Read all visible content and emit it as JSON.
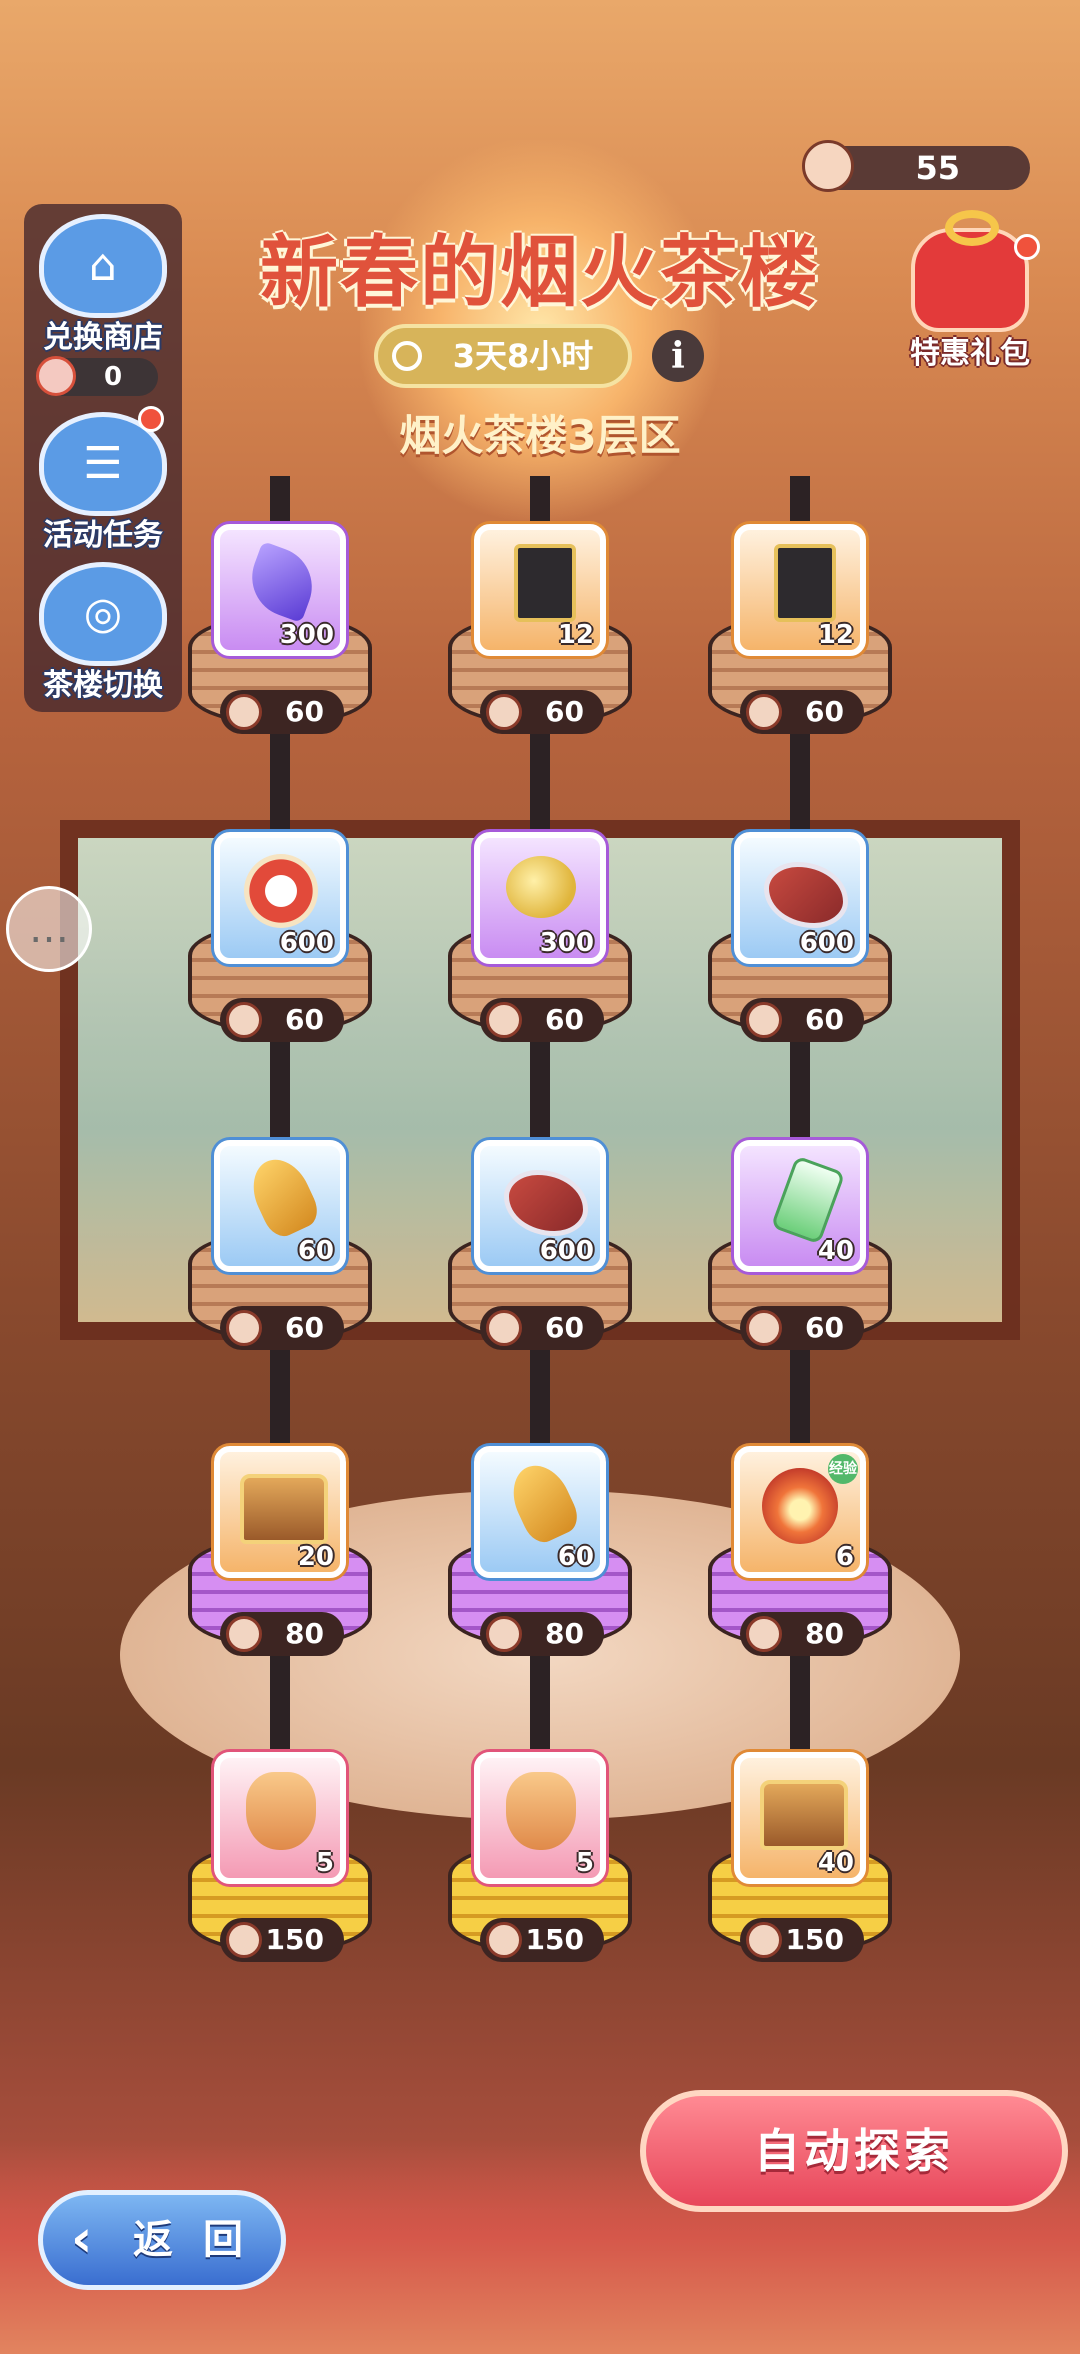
{
  "header": {
    "coin_count": "55",
    "title": "新春的烟火茶楼",
    "timer": "3天8小时",
    "info_symbol": "i",
    "floor_label": "烟火茶楼3层区"
  },
  "sidebar": {
    "items": [
      {
        "label": "兑换商店",
        "icon": "shop-icon",
        "glyph": "⌂"
      },
      {
        "label": "活动任务",
        "icon": "task-clipboard-icon",
        "glyph": "☰"
      },
      {
        "label": "茶楼切换",
        "icon": "steamer-switch-icon",
        "glyph": "◎"
      }
    ],
    "token_count": "0"
  },
  "gift": {
    "label": "特惠礼包",
    "icon": "gift-bag-icon"
  },
  "chat": {
    "icon": "chat-bubble-icon",
    "glyph": "…"
  },
  "grid": {
    "rows": [
      {
        "tier": "wood",
        "cells": [
          {
            "item": "crystal",
            "rarity": "purple",
            "qty": "300",
            "cost": "60"
          },
          {
            "item": "ticket",
            "rarity": "orange",
            "qty": "12",
            "cost": "60"
          },
          {
            "item": "ticket",
            "rarity": "orange",
            "qty": "12",
            "cost": "60"
          }
        ]
      },
      {
        "tier": "wood",
        "cells": [
          {
            "item": "plate",
            "rarity": "blue",
            "qty": "600",
            "cost": "60"
          },
          {
            "item": "gold",
            "rarity": "purple",
            "qty": "300",
            "cost": "60"
          },
          {
            "item": "meat",
            "rarity": "blue",
            "qty": "600",
            "cost": "60"
          }
        ]
      },
      {
        "tier": "wood",
        "cells": [
          {
            "item": "amber",
            "rarity": "blue",
            "qty": "60",
            "cost": "60"
          },
          {
            "item": "meat",
            "rarity": "blue",
            "qty": "600",
            "cost": "60"
          },
          {
            "item": "bottle",
            "rarity": "purple",
            "qty": "40",
            "cost": "60"
          }
        ]
      },
      {
        "tier": "purple",
        "cells": [
          {
            "item": "chest",
            "rarity": "orange",
            "qty": "20",
            "cost": "80"
          },
          {
            "item": "amber",
            "rarity": "blue",
            "qty": "60",
            "cost": "80"
          },
          {
            "item": "orb",
            "rarity": "orange",
            "qty": "6",
            "cost": "80",
            "badge": "经验"
          }
        ]
      },
      {
        "tier": "gold",
        "cells": [
          {
            "item": "fox",
            "rarity": "pink",
            "qty": "5",
            "cost": "150"
          },
          {
            "item": "fox",
            "rarity": "pink",
            "qty": "5",
            "cost": "150"
          },
          {
            "item": "chest",
            "rarity": "orange",
            "qty": "40",
            "cost": "150"
          }
        ]
      }
    ]
  },
  "footer": {
    "auto_explore": "自动探索",
    "back": "返 回",
    "back_arrow": "‹"
  },
  "colors": {
    "title": "#e0523b",
    "auto_button": "#e7465a",
    "back_button": "#3a6ed0"
  }
}
